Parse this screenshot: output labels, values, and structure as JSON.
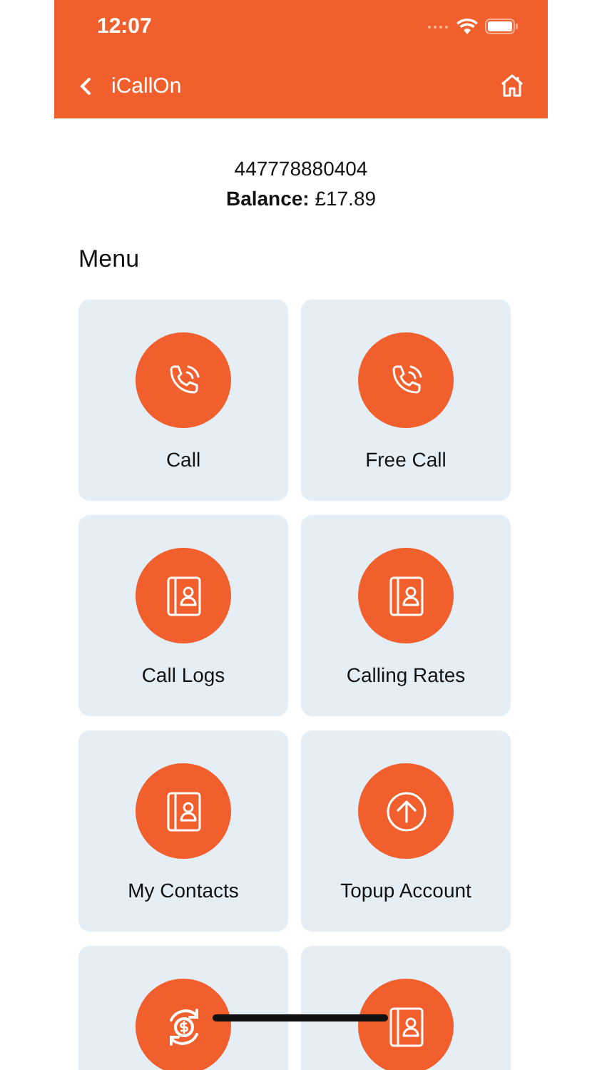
{
  "status_bar": {
    "time": "12:07"
  },
  "nav_bar": {
    "title": "iCallOn"
  },
  "account": {
    "number": "447778880404",
    "balance_label": "Balance:",
    "balance": "£17.89"
  },
  "menu": {
    "title": "Menu",
    "items": [
      {
        "label": "Call",
        "kind": "phone"
      },
      {
        "label": "Free Call",
        "kind": "phone"
      },
      {
        "label": "Call Logs",
        "kind": "book"
      },
      {
        "label": "Calling Rates",
        "kind": "book"
      },
      {
        "label": "My Contacts",
        "kind": "book"
      },
      {
        "label": "Topup Account",
        "kind": "upload"
      },
      {
        "kind": "exchange"
      },
      {
        "kind": "book"
      }
    ]
  }
}
